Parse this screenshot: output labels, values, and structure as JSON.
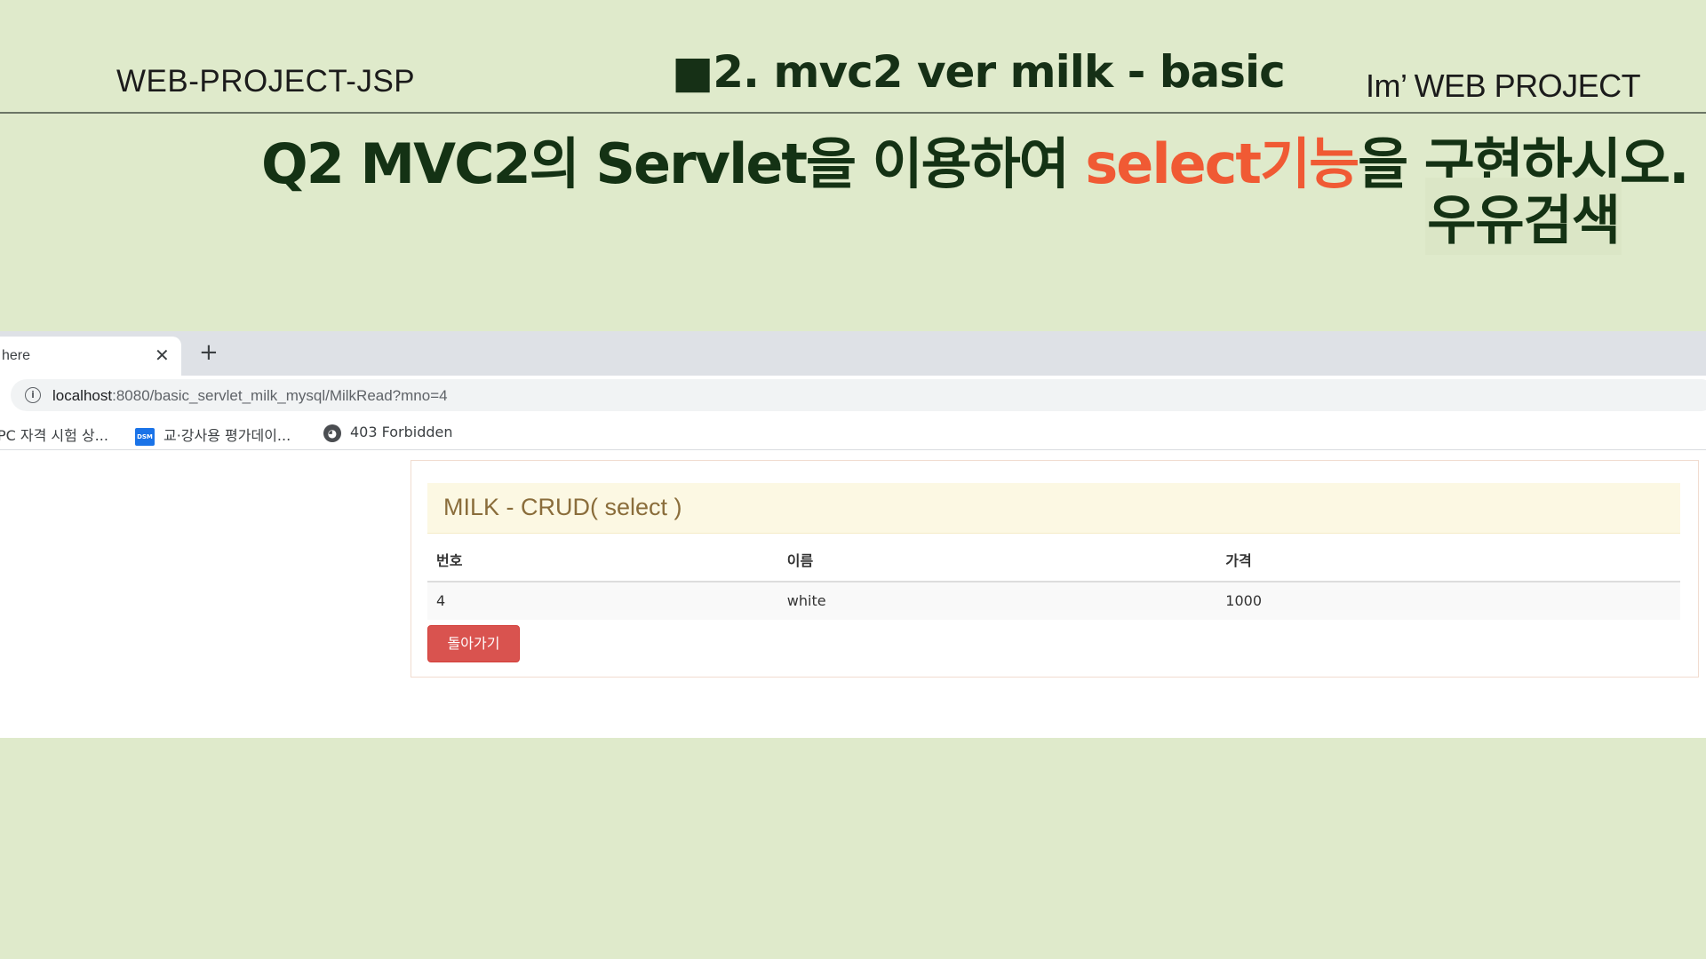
{
  "slide": {
    "header_left": "WEB-PROJECT-JSP",
    "header_center": "■2. mvc2 ver  milk - basic",
    "header_right": "Im’ WEB PROJECT",
    "question_prefix": "Q2  MVC2의 Servlet을 이용하여 ",
    "question_highlight": "select기능",
    "question_suffix": "을 구현하시오.",
    "subtitle": "우유검색",
    "colors": {
      "background": "#dfeacb",
      "title_green": "#143214",
      "highlight": "#f05a34"
    }
  },
  "browser": {
    "tab_title": "here",
    "tab_close_icon": "close-icon",
    "new_tab_icon": "plus-icon",
    "url_host": "localhost",
    "url_path": ":8080/basic_servlet_milk_mysql/MilkRead?mno=4",
    "bookmarks": [
      {
        "label": "PC 자격 시험 상...",
        "icon": "none"
      },
      {
        "label": "교·강사용 평가데이...",
        "icon": "dsm-icon",
        "icon_text": "DSM"
      },
      {
        "label": "403 Forbidden",
        "icon": "globe-icon"
      }
    ]
  },
  "page": {
    "panel_title": "MILK - CRUD( select )",
    "table": {
      "headers": [
        "번호",
        "이름",
        "가격"
      ],
      "rows": [
        [
          "4",
          "white",
          "1000"
        ]
      ]
    },
    "back_button": "돌아가기",
    "colors": {
      "panel_heading_bg": "#fcf8e3",
      "panel_title": "#8a6d3b",
      "danger_button": "#d9534f"
    }
  }
}
